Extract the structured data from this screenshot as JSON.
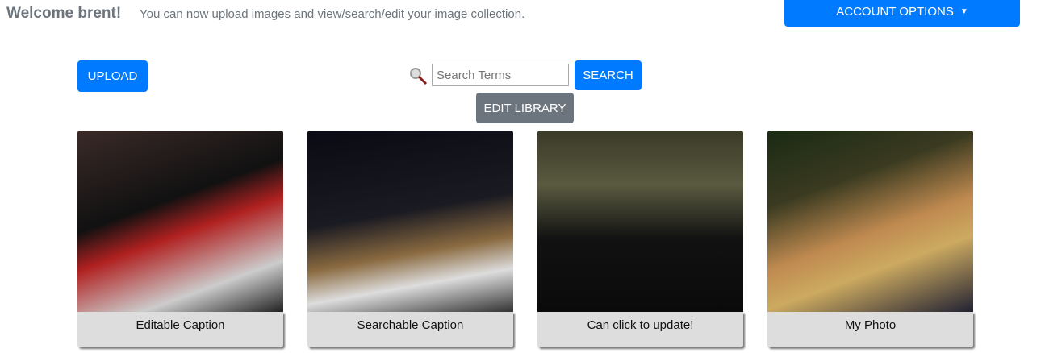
{
  "header": {
    "welcome": "Welcome brent!",
    "subtitle": "You can now upload images and view/search/edit your image collection.",
    "account_label": "ACCOUNT OPTIONS"
  },
  "toolbar": {
    "upload": "UPLOAD",
    "search_placeholder": "Search Terms",
    "search": "SEARCH",
    "edit": "EDIT LIBRARY"
  },
  "cards": [
    {
      "caption": "Editable Caption"
    },
    {
      "caption": "Searchable Caption"
    },
    {
      "caption": "Can click to update!"
    },
    {
      "caption": "My Photo"
    }
  ]
}
